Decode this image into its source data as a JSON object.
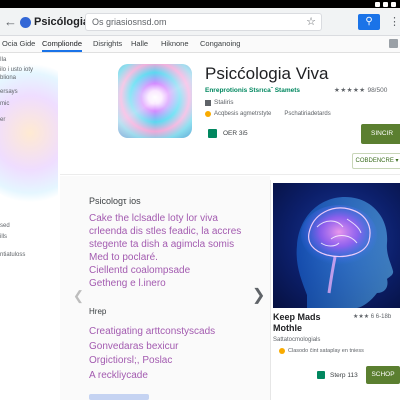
{
  "browser": {
    "app_title": "Psicólogia",
    "url": "Os griasiosnsd.om",
    "back_icon": "back-arrow-icon",
    "menu_icon": "kebab-menu-icon"
  },
  "nav_tabs": [
    {
      "label": "Ocia Gide"
    },
    {
      "label": "Complionde"
    },
    {
      "label": "Disrights"
    },
    {
      "label": "Halle"
    },
    {
      "label": "Hiknone"
    },
    {
      "label": "Conganoing"
    }
  ],
  "sidebar": {
    "items": [
      "Ila",
      "ilo i usto ioty",
      "bliona",
      "ersays",
      "mic",
      "er",
      "sed",
      "ills",
      "ntiatuloss"
    ]
  },
  "app": {
    "name": "Psicćologia Viva",
    "developer": "Enreprotionis  Stsrıcaˇ  Stamets",
    "rating_stars": "★★★★★",
    "rating_count": "98/500",
    "category": "Staliris",
    "meta_left": "Acqbesis agmetrstyte",
    "meta_right": "Pschatiriadetards",
    "wishlist_label": "OER 3i5",
    "install_label": "SINCIR",
    "secondary_label": "COBDENCRE ▾"
  },
  "description": {
    "title": "Psicologτ ios",
    "lines": [
      "Cake the lclsadle loty lor viva",
      "crleenda dis stles feadic, la accres",
      "stegente ta dish a agimcla somis",
      "Med to poclaré.",
      "Ciellentd coalompsade",
      "Getheng e l.inero"
    ],
    "subtitle": "Hrep",
    "lines2": [
      "Creatigating arttconstyscads",
      "Gonvedaras bexicur",
      "Orgictiorsl;, Poslac",
      "A reckliycade"
    ]
  },
  "card": {
    "title_line1": "Keep Mads",
    "title_line2": "Mothle",
    "rating": "★★★ 6  6-18b",
    "subtitle": "Sattatocmologials",
    "meta": "Clasodo čint sataplay en tniess",
    "steps_label": "Sterp 113",
    "shop_label": "SCHOP"
  },
  "colors": {
    "accent_blue": "#1a73e8",
    "install_green": "#5b7f30",
    "developer_green": "#01875f",
    "description_purple": "#a35bb0"
  }
}
